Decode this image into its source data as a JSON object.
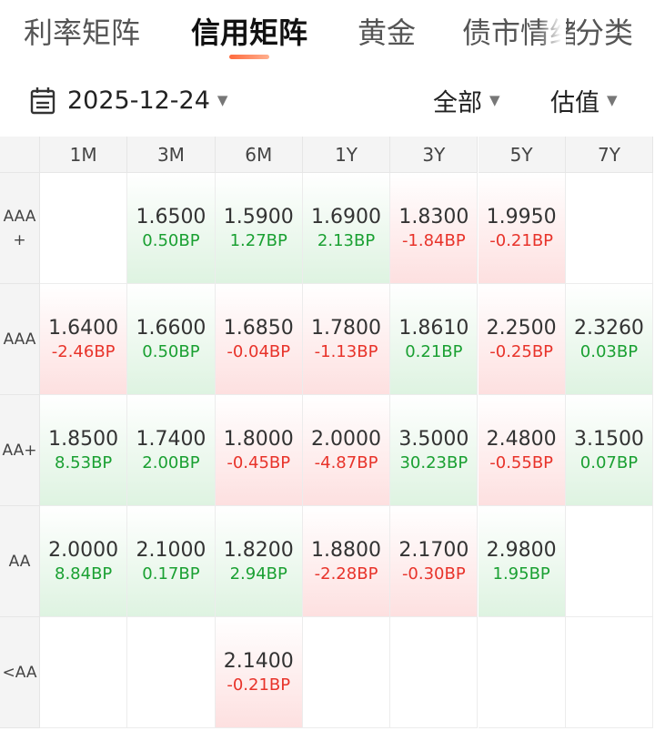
{
  "tabs": [
    {
      "label": "利率矩阵",
      "active": false
    },
    {
      "label": "信用矩阵",
      "active": true
    },
    {
      "label": "黄金",
      "active": false
    },
    {
      "label": "债市情绪",
      "active": false
    },
    {
      "label": "分类",
      "active": false
    }
  ],
  "toolbar": {
    "date": "2025-12-24",
    "filter_label": "全部",
    "metric_label": "估值"
  },
  "colors": {
    "up": "#e8332a",
    "down": "#1aa032",
    "accent": "#ff6a3d"
  },
  "matrix": {
    "columns": [
      "1M",
      "3M",
      "6M",
      "1Y",
      "3Y",
      "5Y",
      "7Y"
    ],
    "rows": [
      {
        "label": "AAA\n+",
        "cells": [
          null,
          {
            "value": "1.6500",
            "change": "0.50BP",
            "dir": "down"
          },
          {
            "value": "1.5900",
            "change": "1.27BP",
            "dir": "down"
          },
          {
            "value": "1.6900",
            "change": "2.13BP",
            "dir": "down"
          },
          {
            "value": "1.8300",
            "change": "-1.84BP",
            "dir": "up"
          },
          {
            "value": "1.9950",
            "change": "-0.21BP",
            "dir": "up"
          },
          null
        ]
      },
      {
        "label": "AAA",
        "cells": [
          {
            "value": "1.6400",
            "change": "-2.46BP",
            "dir": "up"
          },
          {
            "value": "1.6600",
            "change": "0.50BP",
            "dir": "down"
          },
          {
            "value": "1.6850",
            "change": "-0.04BP",
            "dir": "up"
          },
          {
            "value": "1.7800",
            "change": "-1.13BP",
            "dir": "up"
          },
          {
            "value": "1.8610",
            "change": "0.21BP",
            "dir": "down"
          },
          {
            "value": "2.2500",
            "change": "-0.25BP",
            "dir": "up"
          },
          {
            "value": "2.3260",
            "change": "0.03BP",
            "dir": "down"
          }
        ]
      },
      {
        "label": "AA+",
        "cells": [
          {
            "value": "1.8500",
            "change": "8.53BP",
            "dir": "down"
          },
          {
            "value": "1.7400",
            "change": "2.00BP",
            "dir": "down"
          },
          {
            "value": "1.8000",
            "change": "-0.45BP",
            "dir": "up"
          },
          {
            "value": "2.0000",
            "change": "-4.87BP",
            "dir": "up"
          },
          {
            "value": "3.5000",
            "change": "30.23BP",
            "dir": "down"
          },
          {
            "value": "2.4800",
            "change": "-0.55BP",
            "dir": "up"
          },
          {
            "value": "3.1500",
            "change": "0.07BP",
            "dir": "down"
          }
        ]
      },
      {
        "label": "AA",
        "cells": [
          {
            "value": "2.0000",
            "change": "8.84BP",
            "dir": "down"
          },
          {
            "value": "2.1000",
            "change": "0.17BP",
            "dir": "down"
          },
          {
            "value": "1.8200",
            "change": "2.94BP",
            "dir": "down"
          },
          {
            "value": "1.8800",
            "change": "-2.28BP",
            "dir": "up"
          },
          {
            "value": "2.1700",
            "change": "-0.30BP",
            "dir": "up"
          },
          {
            "value": "2.9800",
            "change": "1.95BP",
            "dir": "down"
          },
          null
        ]
      },
      {
        "label": "<AA",
        "cells": [
          null,
          null,
          {
            "value": "2.1400",
            "change": "-0.21BP",
            "dir": "up"
          },
          null,
          null,
          null,
          null
        ]
      }
    ]
  }
}
